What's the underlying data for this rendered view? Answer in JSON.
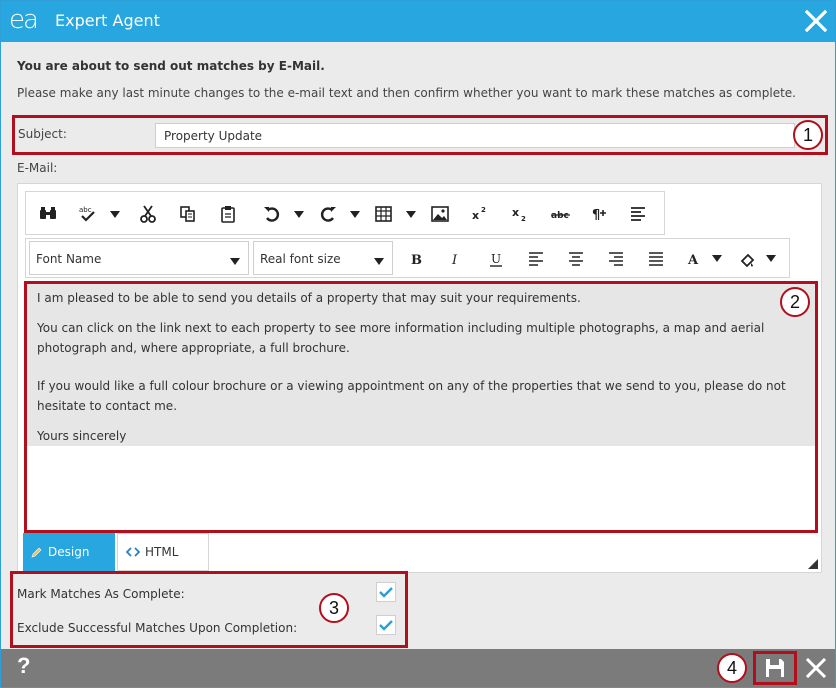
{
  "window": {
    "logo": "ea",
    "title": "Expert Agent"
  },
  "intro": {
    "heading": "You are about to send out matches by E-Mail.",
    "text": "Please make any last minute changes to the e-mail text and then confirm whether you want to mark these matches as complete."
  },
  "subject": {
    "label": "Subject:",
    "value": "Property Update"
  },
  "email": {
    "label": "E-Mail:",
    "font_name": "Font Name",
    "font_size": "Real font size",
    "paragraphs": [
      "I am pleased to be able to send you details of a property that may suit your requirements.",
      "You can click on the link next to each property to see more information including multiple photographs, a map and aerial photograph and, where appropriate, a full brochure.",
      "If you would like a full colour brochure or a viewing appointment on any of the properties that we send to you, please do not hesitate to contact me.",
      "Yours sincerely"
    ],
    "tabs": {
      "design": "Design",
      "html": "HTML"
    }
  },
  "options": {
    "mark_complete": "Mark Matches As Complete:",
    "exclude_successful": "Exclude Successful Matches Upon Completion:"
  },
  "footer": {
    "help": "?"
  },
  "callouts": [
    "1",
    "2",
    "3",
    "4"
  ],
  "colors": {
    "accent": "#27a6df",
    "highlight": "#b10f1d",
    "footer": "#7b7b7b"
  }
}
